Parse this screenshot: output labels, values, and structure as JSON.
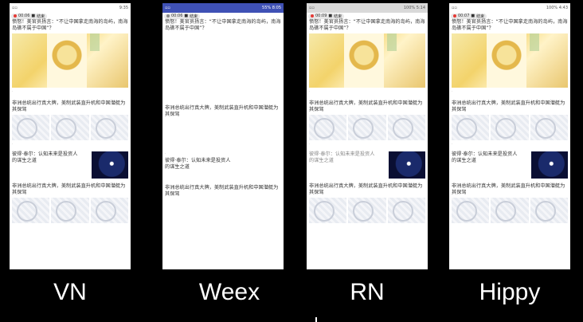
{
  "panels": [
    {
      "id": "vn",
      "label": "VN",
      "statusbar": "white",
      "time": "9:35",
      "battery": "",
      "rec": "00:06",
      "rec_label": "结束",
      "show_hero": true,
      "show_thumbs": true,
      "show_side_img": true
    },
    {
      "id": "weex",
      "label": "Weex",
      "statusbar": "blue",
      "time": "8:05",
      "battery": "55%",
      "rec": "00:06",
      "rec_label": "结束",
      "show_hero": false,
      "show_thumbs": false,
      "show_side_img": false
    },
    {
      "id": "rn",
      "label": "RN",
      "statusbar": "grey",
      "time": "5:14",
      "battery": "100%",
      "rec": "00:09",
      "rec_label": "结束",
      "show_hero": true,
      "show_thumbs": true,
      "show_side_img": true
    },
    {
      "id": "hippy",
      "label": "Hippy",
      "statusbar": "white",
      "time": "4:43",
      "battery": "100%",
      "rec": "00:07",
      "rec_label": "结束",
      "show_hero": true,
      "show_thumbs": true,
      "show_side_img": true
    }
  ],
  "feed": {
    "article1_title": "愤怒！美官员扬言：“不让中国拿走南海的岛屿，南海岛礁不属于中国”？",
    "article2_title": "非洲总统出行真大牌，美制武装直升机和中国潜艇为其保驾",
    "article3_title": "彼得·泰尔：认知未来是投资人的谋生之道",
    "article4_title": "非洲总统出行真大牌，美制武装直升机和中国潜艇为其保驾"
  }
}
